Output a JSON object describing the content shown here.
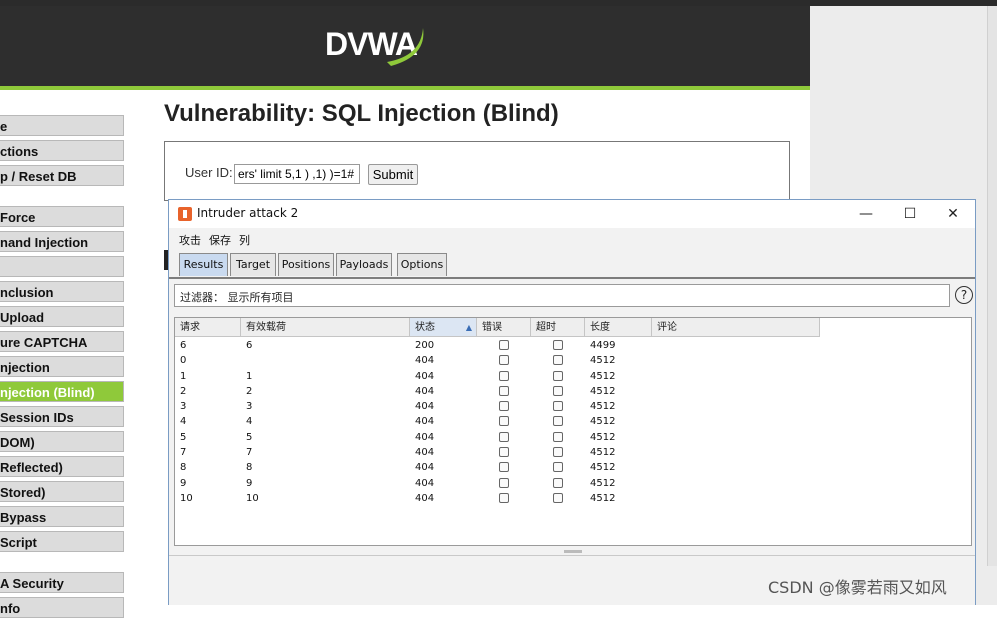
{
  "dvwa": {
    "logo": "DVWA",
    "page_title": "Vulnerability: SQL Injection (Blind)",
    "user_id_label": "User ID:",
    "user_id_value": "ers' limit 5,1 ) ,1) )=1#",
    "submit_label": "Submit",
    "menu_group1": [
      "e",
      "ctions",
      "p / Reset DB"
    ],
    "menu_group2": [
      "Force",
      "nand Injection",
      "",
      "nclusion",
      "Upload",
      "ure CAPTCHA",
      "njection",
      "njection (Blind)",
      "Session IDs",
      "DOM)",
      "Reflected)",
      "Stored)",
      "Bypass",
      "Script"
    ],
    "menu_group3": [
      "A Security",
      "nfo"
    ],
    "active_menu": "njection (Blind)"
  },
  "burp": {
    "title": "Intruder attack 2",
    "menu": [
      "攻击",
      "保存",
      "列"
    ],
    "tabs": [
      "Results",
      "Target",
      "Positions",
      "Payloads",
      "Options"
    ],
    "filter_text": "过滤器：  显示所有项目",
    "help_icon": "?",
    "window_controls": [
      "—",
      "☐",
      "✕"
    ],
    "columns": [
      "请求",
      "有效载荷",
      "状态",
      "错误",
      "超时",
      "长度",
      "评论"
    ],
    "sorted_column": "状态",
    "rows": [
      {
        "request": "6",
        "payload": "6",
        "status": "200",
        "length": "4499"
      },
      {
        "request": "0",
        "payload": "",
        "status": "404",
        "length": "4512"
      },
      {
        "request": "1",
        "payload": "1",
        "status": "404",
        "length": "4512"
      },
      {
        "request": "2",
        "payload": "2",
        "status": "404",
        "length": "4512"
      },
      {
        "request": "3",
        "payload": "3",
        "status": "404",
        "length": "4512"
      },
      {
        "request": "4",
        "payload": "4",
        "status": "404",
        "length": "4512"
      },
      {
        "request": "5",
        "payload": "5",
        "status": "404",
        "length": "4512"
      },
      {
        "request": "7",
        "payload": "7",
        "status": "404",
        "length": "4512"
      },
      {
        "request": "8",
        "payload": "8",
        "status": "404",
        "length": "4512"
      },
      {
        "request": "9",
        "payload": "9",
        "status": "404",
        "length": "4512"
      },
      {
        "request": "10",
        "payload": "10",
        "status": "404",
        "length": "4512"
      }
    ]
  },
  "watermark": "CSDN @像雾若雨又如风",
  "colors": {
    "accent_green": "#8fc93a",
    "header_dark": "#2e2e2e",
    "burp_orange": "#e8632b"
  }
}
